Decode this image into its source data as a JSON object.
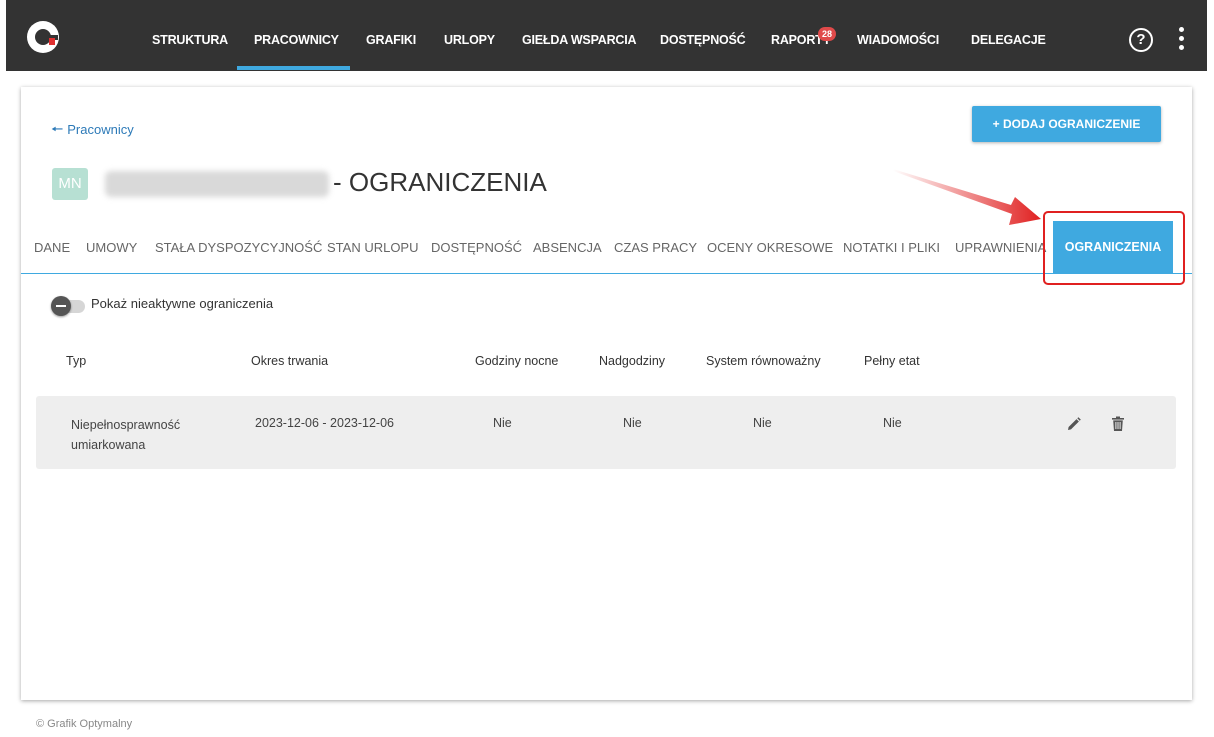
{
  "nav": {
    "items": [
      "STRUKTURA",
      "PRACOWNICY",
      "GRAFIKI",
      "URLOPY",
      "GIEŁDA WSPARCIA",
      "DOSTĘPNOŚĆ",
      "RAPORTY",
      "WIADOMOŚCI",
      "DELEGACJE"
    ],
    "active": "PRACOWNICY",
    "raporty_badge": "28",
    "help_label": "?"
  },
  "header": {
    "back_label": "Pracownicy",
    "add_button": "+  DODAJ OGRANICZENIE",
    "avatar_initials": "MN",
    "title": "- OGRANICZENIA"
  },
  "tabs": [
    "DANE",
    "UMOWY",
    "STAŁA DYSPOZYCYJNOŚĆ",
    "STAN URLOPU",
    "DOSTĘPNOŚĆ",
    "ABSENCJA",
    "CZAS PRACY",
    "OCENY OKRESOWE",
    "NOTATKI I PLIKI",
    "UPRAWNIENIA",
    "OGRANICZENIA"
  ],
  "active_tab": "OGRANICZENIA",
  "toggle": {
    "label": "Pokaż nieaktywne ograniczenia",
    "checked": false
  },
  "table": {
    "headers": [
      "Typ",
      "Okres trwania",
      "Godziny nocne",
      "Nadgodziny",
      "System równoważny",
      "Pełny etat"
    ],
    "rows": [
      {
        "typ": "Niepełnosprawność umiarkowana",
        "okres": "2023-12-06 - 2023-12-06",
        "godziny_nocne": "Nie",
        "nadgodziny": "Nie",
        "system": "Nie",
        "pelny_etat": "Nie"
      }
    ]
  },
  "footer": "© Grafik Optymalny",
  "colors": {
    "accent": "#3fa9e0",
    "nav_bg": "#333333",
    "highlight": "#e02020",
    "badge": "#e04a4a"
  }
}
